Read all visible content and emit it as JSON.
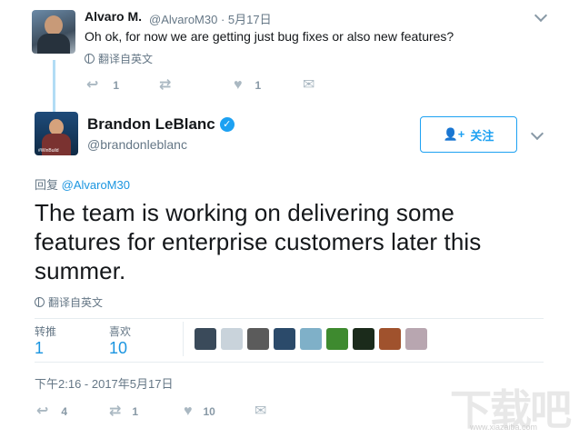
{
  "reply_tweet": {
    "name": "Alvaro M.",
    "handle_date": "@AlvaroM30 · 5月17日",
    "text": "Oh ok, for now we are getting just bug fixes or also new features?",
    "translate": "翻译自英文",
    "actions": {
      "reply_count": "1",
      "retweet_count": "",
      "like_count": "1"
    }
  },
  "main_tweet": {
    "name": "Brandon LeBlanc",
    "handle": "@brandonleblanc",
    "follow_label": "关注",
    "reply_prefix": "回复",
    "reply_mention": "@AlvaroM30",
    "text": "The team is working on delivering some features for enterprise customers later this summer.",
    "translate": "翻译自英文",
    "stats": {
      "retweets_label": "转推",
      "retweets_value": "1",
      "likes_label": "喜欢",
      "likes_value": "10"
    },
    "likers": [
      "#3a4a5a",
      "#c9d3db",
      "#5b5b5b",
      "#2b4a6a",
      "#7fb0c8",
      "#3e8a2f",
      "#1b2b1b",
      "#a0522d",
      "#b8a6b0"
    ],
    "timestamp": "下午2:16 - 2017年5月17日",
    "actions": {
      "reply_count": "4",
      "retweet_count": "1",
      "like_count": "10"
    }
  },
  "watermark": {
    "main": "下载吧",
    "sub": "www.xiazaiba.com"
  },
  "colors": {
    "accent": "#1da1f2",
    "link": "#1b95e0",
    "muted": "#657786",
    "icon": "#aab8c2"
  },
  "icons": [
    "reply-icon",
    "retweet-icon",
    "heart-icon",
    "dm-icon",
    "globe-icon",
    "verified-icon",
    "follow-user-icon",
    "chevron-down-icon"
  ]
}
